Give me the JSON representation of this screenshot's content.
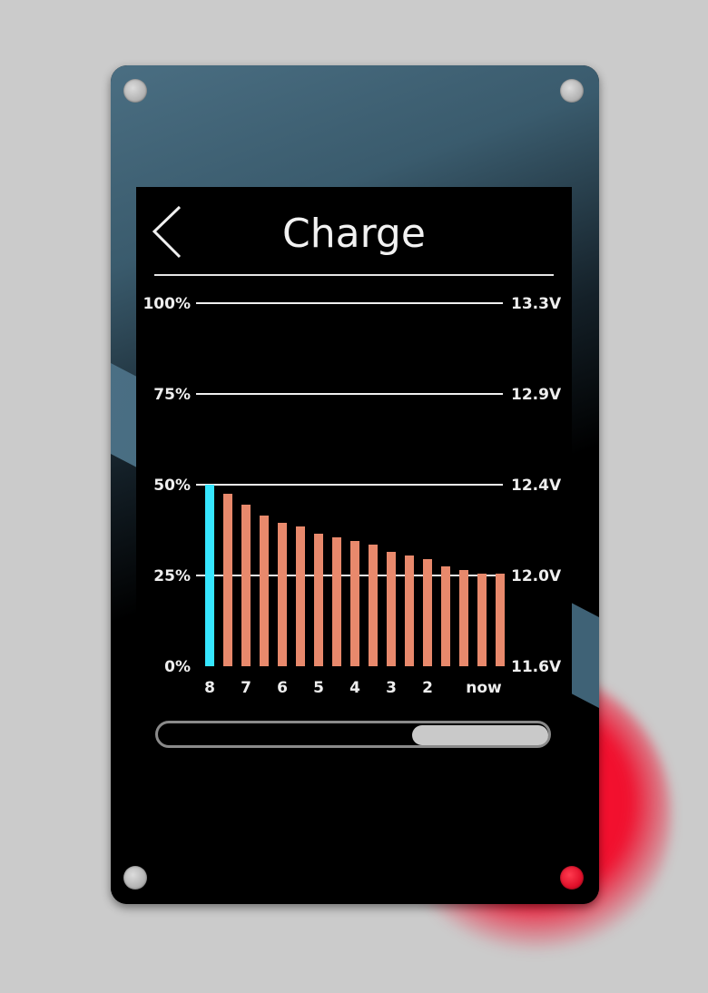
{
  "header": {
    "title": "Charge"
  },
  "icons": {
    "back": "chevron-left-icon"
  },
  "colors": {
    "current_bar": "#36e6ff",
    "history_bar": "#e8896c",
    "gridline": "#f0f0f0",
    "text": "#eeeeee",
    "accent_indicator": "#f0102e"
  },
  "chart_data": {
    "type": "bar",
    "title": "",
    "ylim": [
      0,
      100
    ],
    "left_axis_ticks": [
      "100%",
      "75%",
      "50%",
      "25%",
      "0%"
    ],
    "right_axis_ticks": [
      "13.3V",
      "12.9V",
      "12.4V",
      "12.0V",
      "11.6V"
    ],
    "x_tick_labels": [
      "8",
      "7",
      "6",
      "5",
      "4",
      "3",
      "2",
      "now"
    ],
    "grid": true,
    "series": [
      {
        "values": [
          50,
          47.5,
          44.5,
          41.5,
          39.5,
          38.5,
          36.5,
          35.5,
          34.5,
          33.5,
          31.5,
          30.5,
          29.5,
          27.5,
          26.5,
          25.5,
          25.5
        ]
      }
    ],
    "highlight_index": 0
  },
  "scrollbar": {
    "position": 0.67,
    "visible_fraction": 0.35
  }
}
